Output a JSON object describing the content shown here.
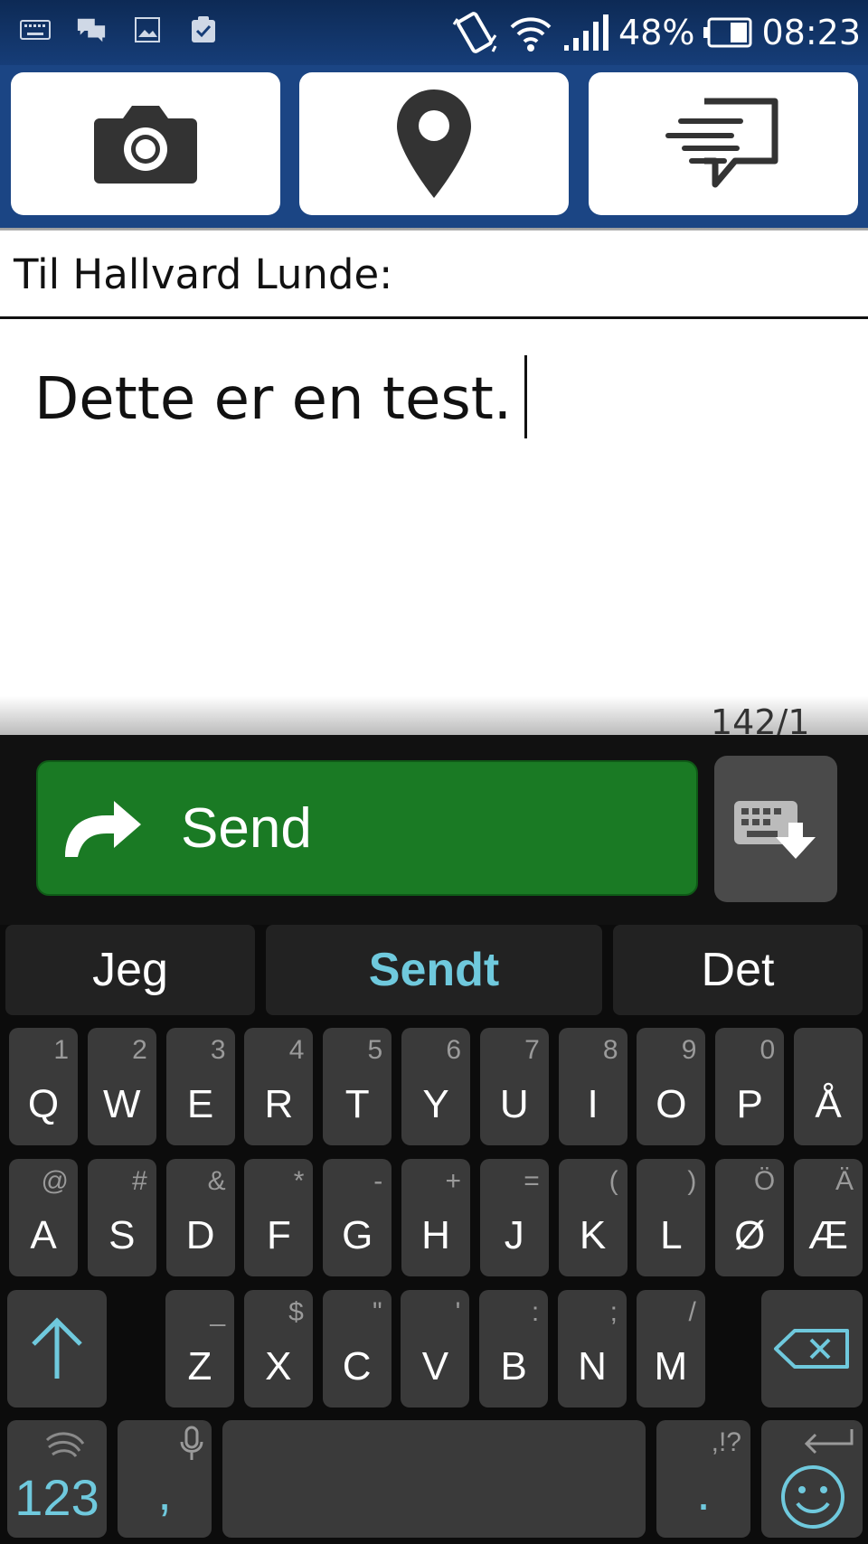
{
  "status_bar": {
    "battery": "48%",
    "time": "08:23",
    "left_icons": [
      "keyboard-icon",
      "chat-icon",
      "image-icon",
      "clipboard-icon"
    ],
    "right_icons": [
      "vibrate-icon",
      "wifi-icon",
      "signal-icon",
      "battery-icon"
    ]
  },
  "toolbar": {
    "buttons": [
      "camera-icon",
      "location-pin-icon",
      "quick-message-icon"
    ]
  },
  "recipient": {
    "label": "Til Hallvard Lunde:"
  },
  "message": {
    "text": "Dette er en test.",
    "counter": "142/1"
  },
  "send": {
    "label": "Send"
  },
  "suggestions": [
    "Jeg",
    "Sendt",
    "Det"
  ],
  "keyboard": {
    "row1": [
      {
        "k": "Q",
        "s": "1"
      },
      {
        "k": "W",
        "s": "2"
      },
      {
        "k": "E",
        "s": "3"
      },
      {
        "k": "R",
        "s": "4"
      },
      {
        "k": "T",
        "s": "5"
      },
      {
        "k": "Y",
        "s": "6"
      },
      {
        "k": "U",
        "s": "7"
      },
      {
        "k": "I",
        "s": "8"
      },
      {
        "k": "O",
        "s": "9"
      },
      {
        "k": "P",
        "s": "0"
      },
      {
        "k": "Å",
        "s": ""
      }
    ],
    "row2": [
      {
        "k": "A",
        "s": "@"
      },
      {
        "k": "S",
        "s": "#"
      },
      {
        "k": "D",
        "s": "&"
      },
      {
        "k": "F",
        "s": "*"
      },
      {
        "k": "G",
        "s": "-"
      },
      {
        "k": "H",
        "s": "+"
      },
      {
        "k": "J",
        "s": "="
      },
      {
        "k": "K",
        "s": "("
      },
      {
        "k": "L",
        "s": ")"
      },
      {
        "k": "Ø",
        "s": "Ö"
      },
      {
        "k": "Æ",
        "s": "Ä"
      }
    ],
    "row3": [
      {
        "k": "Z",
        "s": "_"
      },
      {
        "k": "X",
        "s": "$"
      },
      {
        "k": "C",
        "s": "\""
      },
      {
        "k": "V",
        "s": "'"
      },
      {
        "k": "B",
        "s": ":"
      },
      {
        "k": "N",
        "s": ";"
      },
      {
        "k": "M",
        "s": "/"
      }
    ],
    "num_label": "123",
    "comma": ",",
    "period": ".",
    "punct_hint": ",!?"
  },
  "colors": {
    "toolbar": "#1b4584",
    "send": "#1a7a24",
    "accent": "#6fc9dd"
  }
}
